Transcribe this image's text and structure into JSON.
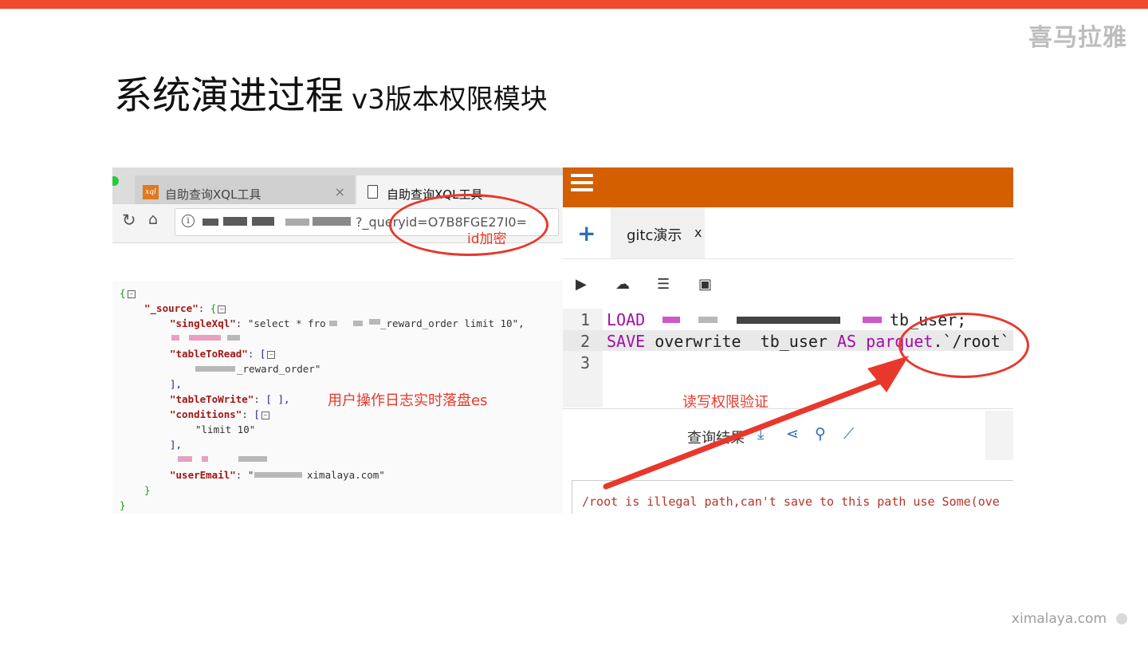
{
  "slide": {
    "title_main": "系统演进过程",
    "title_sub": "v3版本权限模块",
    "logo_cn": "喜马拉雅",
    "footer_brand": "ximalaya.com",
    "accent": "#f04a2f"
  },
  "left_browser": {
    "tab1_label": "自助查询XQL工具",
    "tab1_icon": "xql",
    "tab1_close": "×",
    "tab2_label": "自助查询XQL工具",
    "url_visible": "?_queryid=O7B8FGE27I0=",
    "note_id": "id加密",
    "json_lines": {
      "open": "{",
      "source_key": "\"_source\"",
      "singlexql_key": "\"singleXql\"",
      "singlexql_val_a": "\"select * fro",
      "singlexql_val_b": "_reward_order limit 10\",",
      "tabletoread_key": "\"tableToRead\"",
      "tabletoread_val": "_reward_order\"",
      "close_arr": "],",
      "tabletowrite_key": "\"tableToWrite\"",
      "tabletowrite_val": "[ ],",
      "conditions_key": "\"conditions\"",
      "conditions_val": "\"limit 10\"",
      "close_arr2": "],",
      "useremail_key": "\"userEmail\"",
      "useremail_val": "ximalaya.com\"",
      "close_inner": "}",
      "close_outer": "}"
    },
    "note_es": "用户操作日志实时落盘es"
  },
  "right_editor": {
    "tab_label": "gitc演示",
    "tab_close": "x",
    "code": {
      "line_numbers": [
        "1",
        "2",
        "3"
      ],
      "l1_kw": "LOAD",
      "l1_tail": "tb_user;",
      "l2_kw1": "SAVE",
      "l2_mid": "overwrite  tb_user",
      "l2_kw2": "AS",
      "l2_fmt": "parquet",
      "l2_path": ".`/root`;"
    },
    "note_verify": "读写权限验证",
    "result_label": "查询结果",
    "error_text": "/root is illegal path,can't save to this path use Some(ove"
  }
}
